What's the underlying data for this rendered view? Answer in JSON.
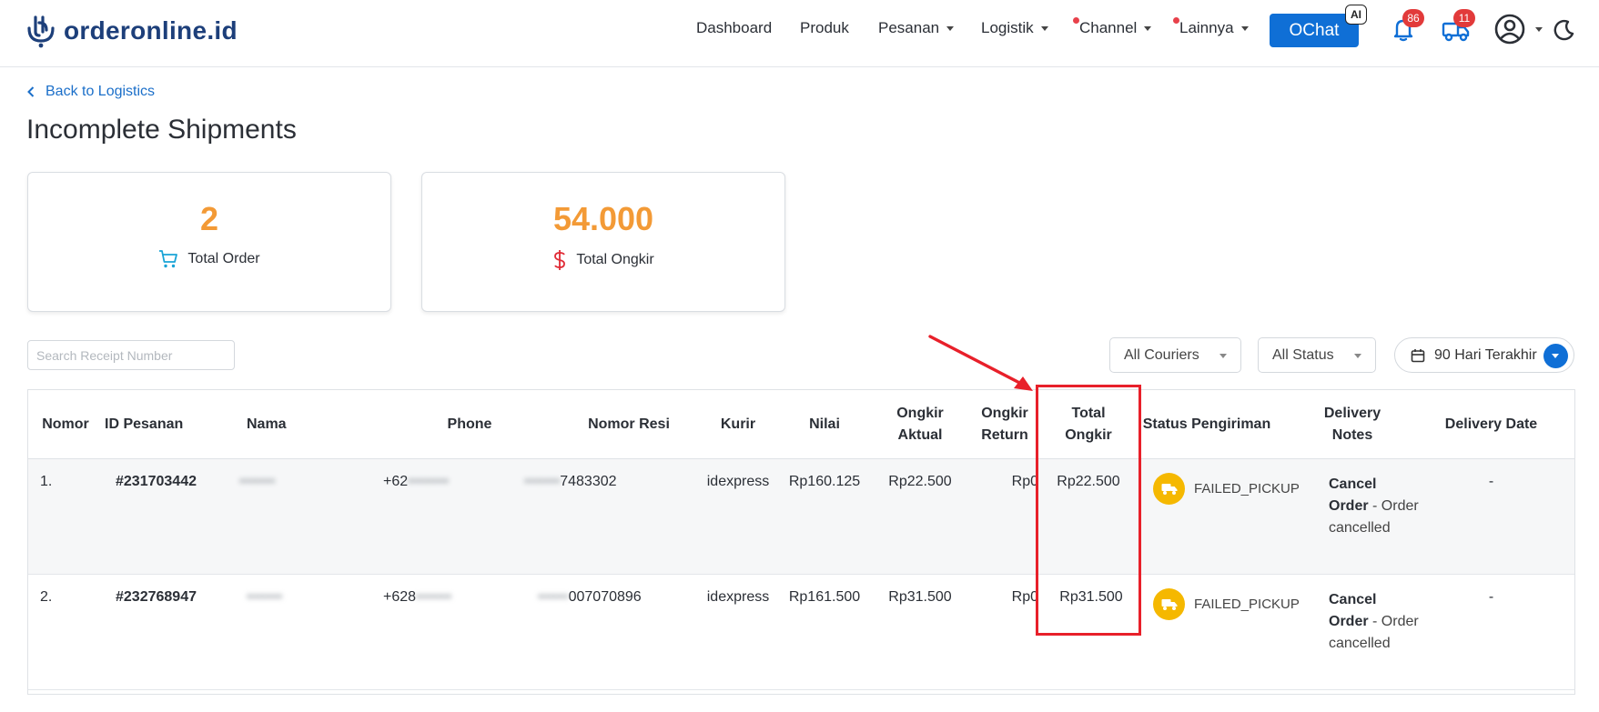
{
  "brand": {
    "name": "orderonline.id",
    "color": "#1d3f7a"
  },
  "nav": [
    {
      "label": "Dashboard",
      "dropdown": false,
      "dot": false
    },
    {
      "label": "Produk",
      "dropdown": false,
      "dot": false
    },
    {
      "label": "Pesanan",
      "dropdown": true,
      "dot": false
    },
    {
      "label": "Logistik",
      "dropdown": true,
      "dot": false
    },
    {
      "label": "Channel",
      "dropdown": true,
      "dot": true
    },
    {
      "label": "Lainnya",
      "dropdown": true,
      "dot": true
    }
  ],
  "ochat": {
    "label": "OChat",
    "badge": "AI"
  },
  "notifications": {
    "count": "86"
  },
  "shipments_badge": {
    "count": "11"
  },
  "back": {
    "label": "Back to Logistics"
  },
  "page": {
    "title": "Incomplete Shipments"
  },
  "stats": [
    {
      "value": "2",
      "label": "Total Order",
      "icon": "cart-icon"
    },
    {
      "value": "54.000",
      "label": "Total Ongkir",
      "icon": "dollar-icon"
    }
  ],
  "filters": {
    "search_placeholder": "Search Receipt Number",
    "courier": "All Couriers",
    "status": "All Status",
    "date_range": "90 Hari Terakhir"
  },
  "table": {
    "headers": {
      "nomor": "Nomor",
      "id": "ID Pesanan",
      "nama": "Nama",
      "phone": "Phone",
      "resi": "Nomor Resi",
      "kurir": "Kurir",
      "nilai": "Nilai",
      "ongkir_aktual": "Ongkir Aktual",
      "ongkir_return": "Ongkir Return",
      "total_ongkir": "Total Ongkir",
      "status": "Status Pengiriman",
      "notes": "Delivery Notes",
      "date": "Delivery Date"
    },
    "rows": [
      {
        "no": "1.",
        "id": "#231703442",
        "nama": "•••••••",
        "phone_visible": "+62",
        "phone_hidden": "••••••••",
        "resi_hidden": "•••••••",
        "resi_visible": "7483302",
        "kurir": "idexpress",
        "nilai": "Rp160.125",
        "ongkir_aktual": "Rp22.500",
        "ongkir_return": "Rp0",
        "total_ongkir": "Rp22.500",
        "status": "FAILED_PICKUP",
        "notes_title": "Cancel Order",
        "notes_detail": "- Order cancelled",
        "date": "-"
      },
      {
        "no": "2.",
        "id": "#232768947",
        "nama": "•••••••",
        "phone_visible": "+628",
        "phone_hidden": "•••••••",
        "resi_hidden": "••••••",
        "resi_visible": "007070896",
        "kurir": "idexpress",
        "nilai": "Rp161.500",
        "ongkir_aktual": "Rp31.500",
        "ongkir_return": "Rp0",
        "total_ongkir": "Rp31.500",
        "status": "FAILED_PICKUP",
        "notes_title": "Cancel Order",
        "notes_detail": "- Order cancelled",
        "date": "-"
      }
    ]
  },
  "colors": {
    "accent": "#0f6fd6",
    "stat": "#f39a36",
    "status": "#f5b800",
    "highlight": "#e8202a"
  }
}
